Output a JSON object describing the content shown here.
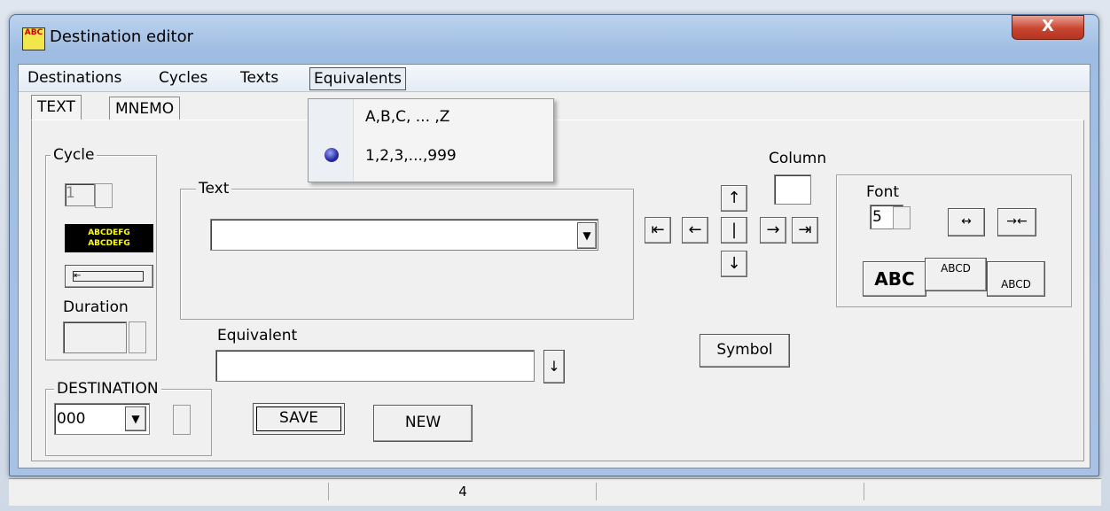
{
  "window": {
    "title": "Destination editor",
    "close_symbol": "X",
    "icon_label": "ABC"
  },
  "menu": {
    "items": [
      "Destinations",
      "Cycles",
      "Texts",
      "Equivalents"
    ]
  },
  "dropdown": {
    "items": [
      "A,B,C, ... ,Z",
      "1,2,3,...,999"
    ],
    "selected_index": 1
  },
  "tabs": [
    "TEXT",
    "MNEMO"
  ],
  "cycle": {
    "label": "Cycle",
    "number": "1",
    "preview_line1": "ABCDEFG",
    "preview_line2": "ABCDEFG",
    "duration_label": "Duration"
  },
  "destination": {
    "label": "DESTINATION",
    "value": "000"
  },
  "text_group": {
    "label": "Text",
    "value": ""
  },
  "equivalent": {
    "label": "Equivalent",
    "value": ""
  },
  "buttons": {
    "save": "SAVE",
    "new": "NEW",
    "symbol": "Symbol"
  },
  "column": {
    "label": "Column",
    "value": ""
  },
  "font": {
    "label": "Font",
    "size": "5",
    "abc_big": "ABC",
    "abcd_small": "ABCD",
    "abcd_low": "ABCD"
  },
  "status_bar": {
    "cell_value": "4"
  },
  "colors": {
    "accent": "#9fbde3",
    "close": "#c8452f",
    "preview_bg": "#000000",
    "preview_fg": "#ffff00"
  }
}
